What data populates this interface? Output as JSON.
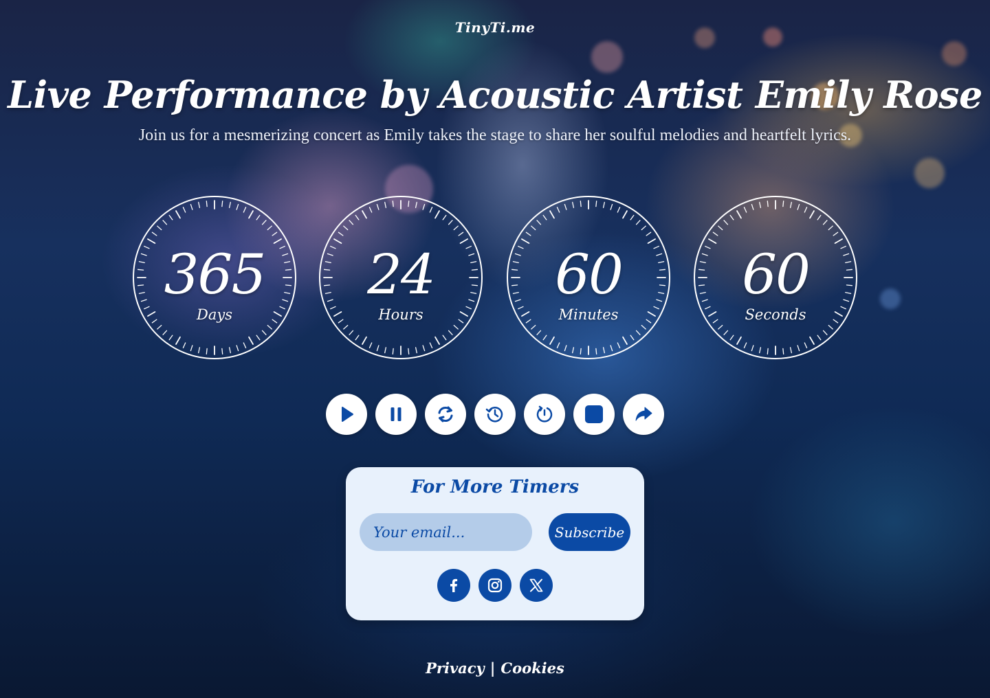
{
  "brand": "TinyTi.me",
  "hero": {
    "title": "Live Performance by Acoustic Artist Emily Rose",
    "subtitle": "Join us for a mesmerizing concert as Emily takes the stage to share her soulful melodies and heartfelt lyrics."
  },
  "countdown": [
    {
      "value": "365",
      "unit": "Days"
    },
    {
      "value": "24",
      "unit": "Hours"
    },
    {
      "value": "60",
      "unit": "Minutes"
    },
    {
      "value": "60",
      "unit": "Seconds"
    }
  ],
  "controls": [
    {
      "name": "play-icon"
    },
    {
      "name": "pause-icon"
    },
    {
      "name": "refresh-icon"
    },
    {
      "name": "history-icon"
    },
    {
      "name": "timer-reset-icon"
    },
    {
      "name": "stop-icon"
    },
    {
      "name": "share-icon"
    }
  ],
  "subscribe": {
    "title": "For More Timers",
    "email_placeholder": "Your email...",
    "button_label": "Subscribe"
  },
  "social": [
    "facebook-icon",
    "instagram-icon",
    "x-icon"
  ],
  "footer": {
    "privacy": "Privacy",
    "separator": "|",
    "cookies": "Cookies"
  },
  "colors": {
    "accent": "#0b4aa5",
    "panel_bg": "#e8f1fc",
    "input_bg": "#b4cce9",
    "text": "#ffffff"
  }
}
